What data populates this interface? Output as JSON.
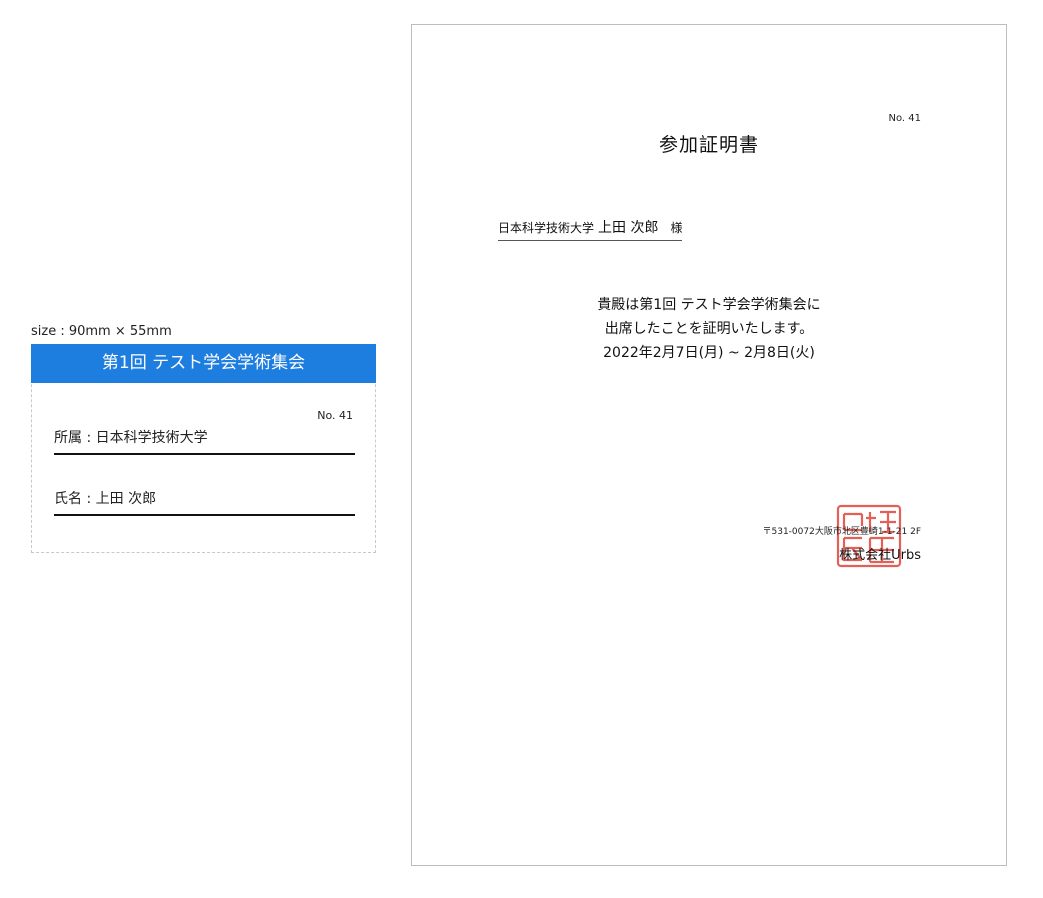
{
  "badge": {
    "size_label": "size : 90mm × 55mm",
    "header_title": "第1回 テスト学会学術集会",
    "number": "No. 41",
    "affiliation_line": "所属 : 日本科学技術大学",
    "name_line": "氏名 : 上田 次郎"
  },
  "certificate": {
    "number": "No. 41",
    "title": "参加証明書",
    "recipient_affiliation": "日本科学技術大学",
    "recipient_name": "上田 次郎",
    "honorific": "様",
    "body_line1": "貴殿は第1回  テスト学会学術集会に",
    "body_line2": "出席したことを証明いたします。",
    "body_line3": "2022年2月7日(月) ~ 2月8日(火)",
    "address": "〒531-0072大阪市北区豊崎1-1-21 2F",
    "company": "株式会社Urbs",
    "seal_color": "#e0453a"
  }
}
